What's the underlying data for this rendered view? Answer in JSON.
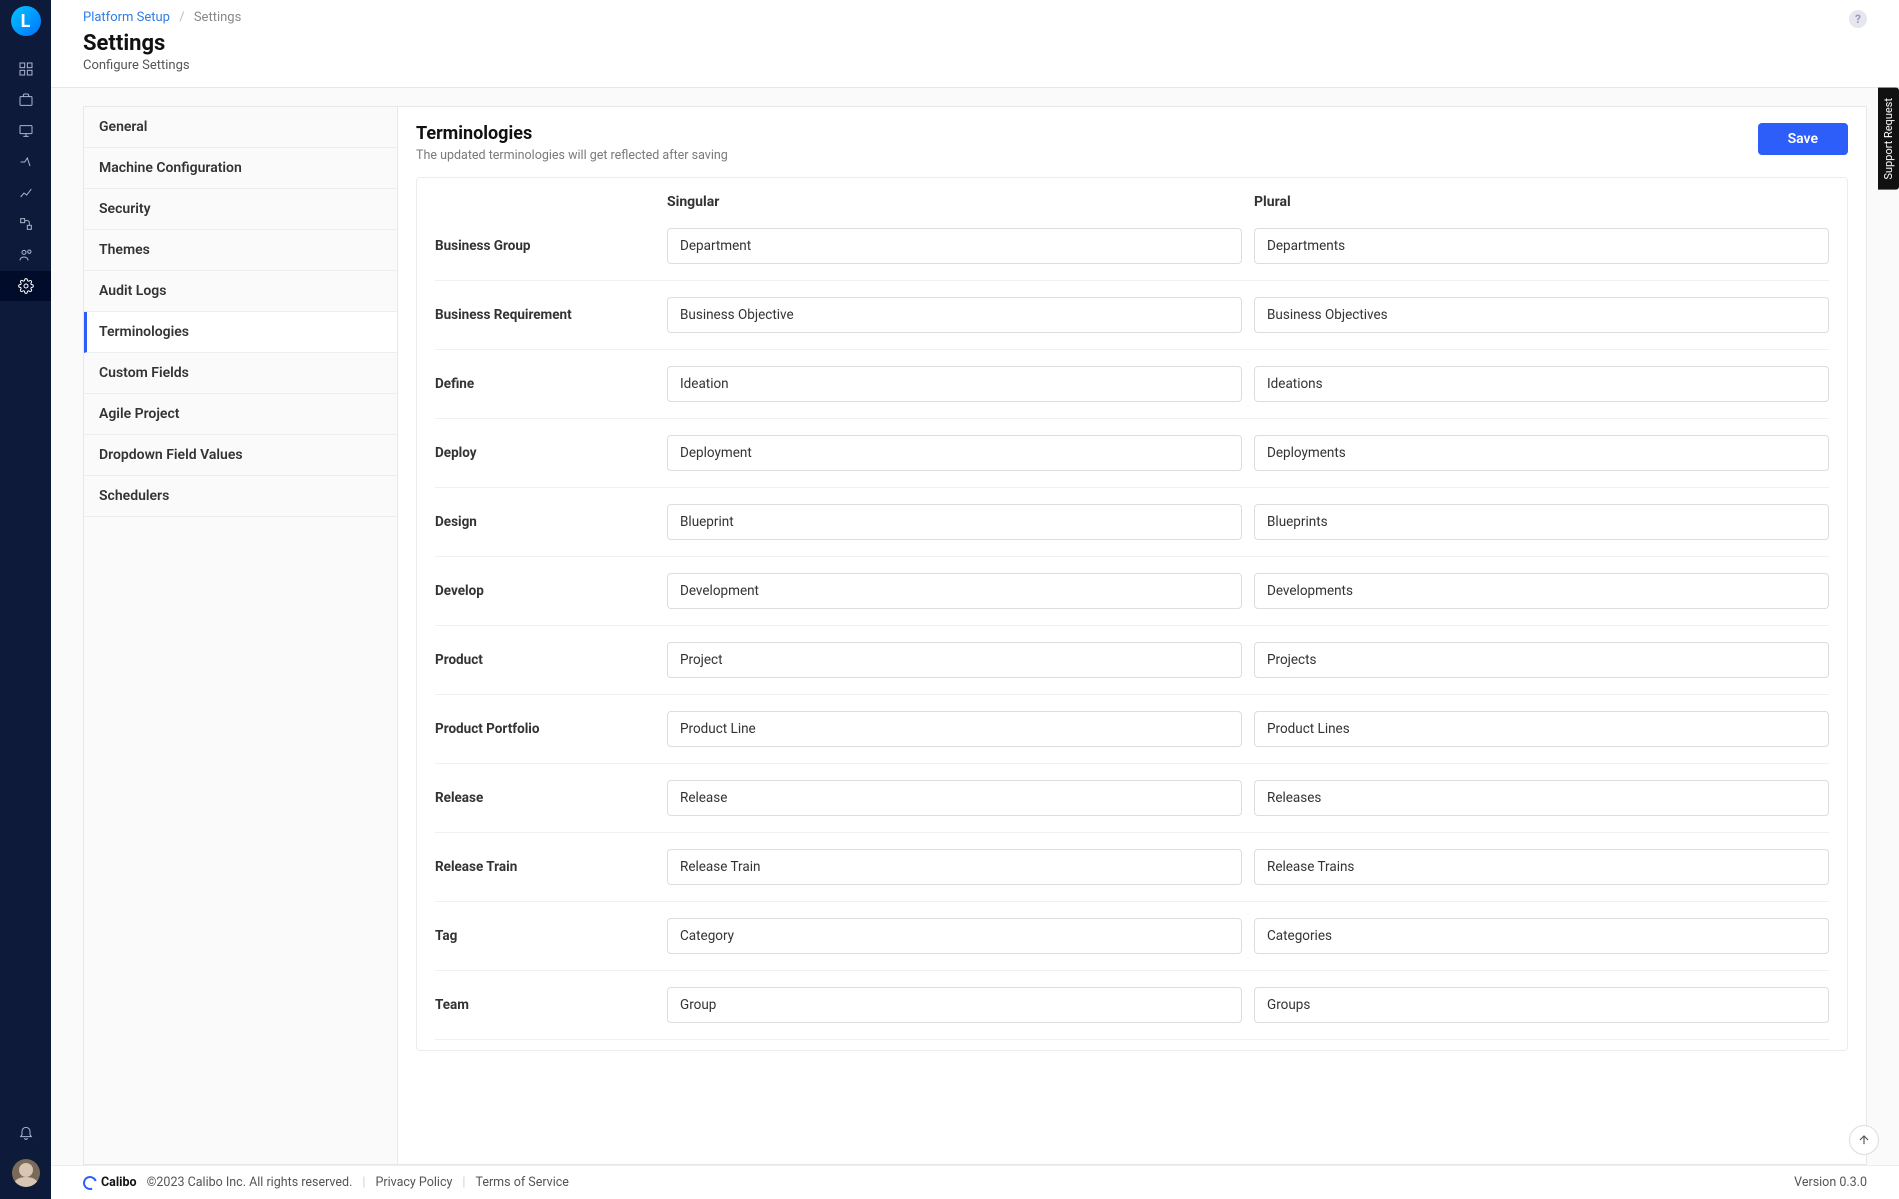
{
  "rail": {
    "logo_letter": "L"
  },
  "header": {
    "breadcrumb_root": "Platform Setup",
    "breadcrumb_current": "Settings",
    "title": "Settings",
    "subtitle": "Configure Settings"
  },
  "settings_nav": {
    "items": [
      {
        "label": "General"
      },
      {
        "label": "Machine Configuration"
      },
      {
        "label": "Security"
      },
      {
        "label": "Themes"
      },
      {
        "label": "Audit Logs"
      },
      {
        "label": "Terminologies"
      },
      {
        "label": "Custom Fields"
      },
      {
        "label": "Agile Project"
      },
      {
        "label": "Dropdown Field Values"
      },
      {
        "label": "Schedulers"
      }
    ],
    "active_index": 5
  },
  "panel": {
    "title": "Terminologies",
    "subtitle": "The updated terminologies will get reflected after saving",
    "save_label": "Save",
    "col_singular": "Singular",
    "col_plural": "Plural",
    "rows": [
      {
        "label": "Business Group",
        "singular": "Department",
        "plural": "Departments"
      },
      {
        "label": "Business Requirement",
        "singular": "Business Objective",
        "plural": "Business Objectives"
      },
      {
        "label": "Define",
        "singular": "Ideation",
        "plural": "Ideations"
      },
      {
        "label": "Deploy",
        "singular": "Deployment",
        "plural": "Deployments"
      },
      {
        "label": "Design",
        "singular": "Blueprint",
        "plural": "Blueprints"
      },
      {
        "label": "Develop",
        "singular": "Development",
        "plural": "Developments"
      },
      {
        "label": "Product",
        "singular": "Project",
        "plural": "Projects"
      },
      {
        "label": "Product Portfolio",
        "singular": "Product Line",
        "plural": "Product Lines"
      },
      {
        "label": "Release",
        "singular": "Release",
        "plural": "Releases"
      },
      {
        "label": "Release Train",
        "singular": "Release Train",
        "plural": "Release Trains"
      },
      {
        "label": "Tag",
        "singular": "Category",
        "plural": "Categories"
      },
      {
        "label": "Team",
        "singular": "Group",
        "plural": "Groups"
      }
    ]
  },
  "footer": {
    "brand": "Calibo",
    "copyright": "©2023 Calibo Inc. All rights reserved.",
    "privacy": "Privacy Policy",
    "terms": "Terms of Service",
    "version": "Version 0.3.0"
  },
  "support_tab": "Support Request"
}
